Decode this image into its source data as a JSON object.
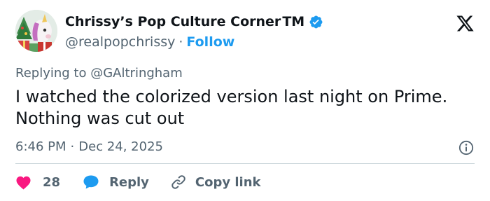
{
  "tweet": {
    "author": {
      "display_name": "Chrissy’s Pop Culture Corner",
      "trademark": "TM",
      "handle": "@realpopchrissy",
      "separator": "·",
      "follow_label": "Follow",
      "verified": true,
      "avatar_icon": "unicorn-christmas-avatar"
    },
    "reply_prefix": "Replying to",
    "reply_to_handle": "@GAltringham",
    "text": "I watched the colorized version last night on Prime. Nothing was cut out",
    "time": "6:46 PM",
    "meta_separator": "·",
    "date": "Dec 24, 2025",
    "actions": {
      "like_count": "28",
      "reply_label": "Reply",
      "copy_label": "Copy link"
    }
  },
  "colors": {
    "accent": "#1d9bf0",
    "like": "#f91880",
    "muted": "#536471",
    "text": "#0f1419",
    "divider": "#cfd9de"
  }
}
